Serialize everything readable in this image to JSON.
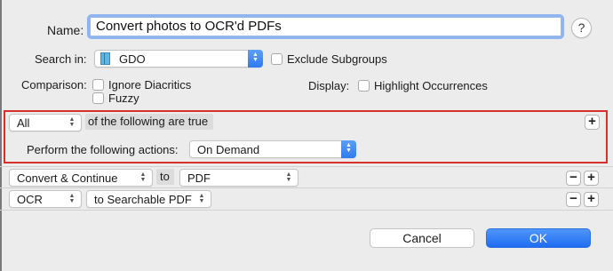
{
  "name_row": {
    "label": "Name:",
    "value": "Convert photos to OCR'd PDFs",
    "help_glyph": "?"
  },
  "search_row": {
    "label": "Search in:",
    "database": "GDO",
    "database_icon": "database-icon",
    "exclude_subgroups": "Exclude Subgroups",
    "exclude_checked": false
  },
  "comparison": {
    "label": "Comparison:",
    "ignore_diacritics": "Ignore Diacritics",
    "fuzzy": "Fuzzy"
  },
  "display": {
    "label": "Display:",
    "highlight": "Highlight Occurrences"
  },
  "criteria": {
    "match_mode": "All",
    "match_text": "of the following are true",
    "perform_label": "Perform the following actions:",
    "perform_value": "On Demand",
    "highlight_color": "#d9302a"
  },
  "actions": [
    {
      "action": "Convert & Continue",
      "connector": "to",
      "target": "PDF"
    },
    {
      "action": "OCR",
      "target": "to Searchable PDF"
    }
  ],
  "buttons": {
    "plus": "+",
    "minus": "−",
    "cancel": "Cancel",
    "ok": "OK"
  },
  "colors": {
    "accent": "#2f7af0",
    "window_bg": "#ececec"
  }
}
